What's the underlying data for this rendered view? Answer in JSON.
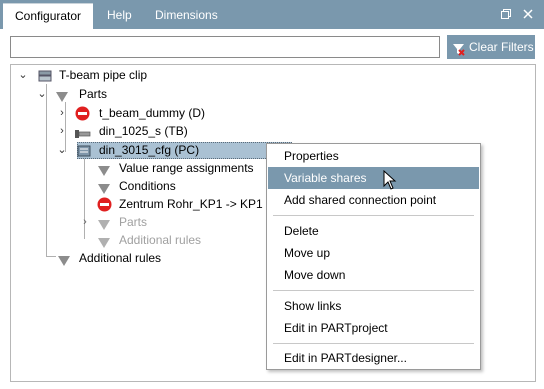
{
  "tabs": [
    {
      "label": "Configurator",
      "active": true
    },
    {
      "label": "Help",
      "active": false
    },
    {
      "label": "Dimensions",
      "active": false
    }
  ],
  "window_controls": {
    "restore_icon": "restore-icon",
    "close_icon": "close-icon"
  },
  "search": {
    "value": "",
    "placeholder": ""
  },
  "clear_filters": {
    "label": "Clear Filters",
    "icon": "clear-filter-icon"
  },
  "tree": {
    "root": "T-beam pipe clip",
    "parts": "Parts",
    "item_t_beam": "t_beam_dummy (D)",
    "item_din1025": "din_1025_s (TB)",
    "item_din3015": "din_3015_cfg (PC)",
    "value_range": "Value range assignments",
    "conditions": "Conditions",
    "zentrum": "Zentrum Rohr_KP1 -> KP1",
    "sub_parts": "Parts",
    "sub_additional": "Additional rules",
    "additional_rules": "Additional rules"
  },
  "context_menu": {
    "properties": "Properties",
    "variable_shares": "Variable shares",
    "add_shared": "Add shared connection point",
    "delete": "Delete",
    "move_up": "Move up",
    "move_down": "Move down",
    "show_links": "Show links",
    "edit_partproject": "Edit in PARTproject",
    "edit_partdesigner": "Edit in PARTdesigner..."
  },
  "colors": {
    "accent": "#7a98ad",
    "selection": "#aac1d3",
    "no_entry": "#e02020"
  }
}
